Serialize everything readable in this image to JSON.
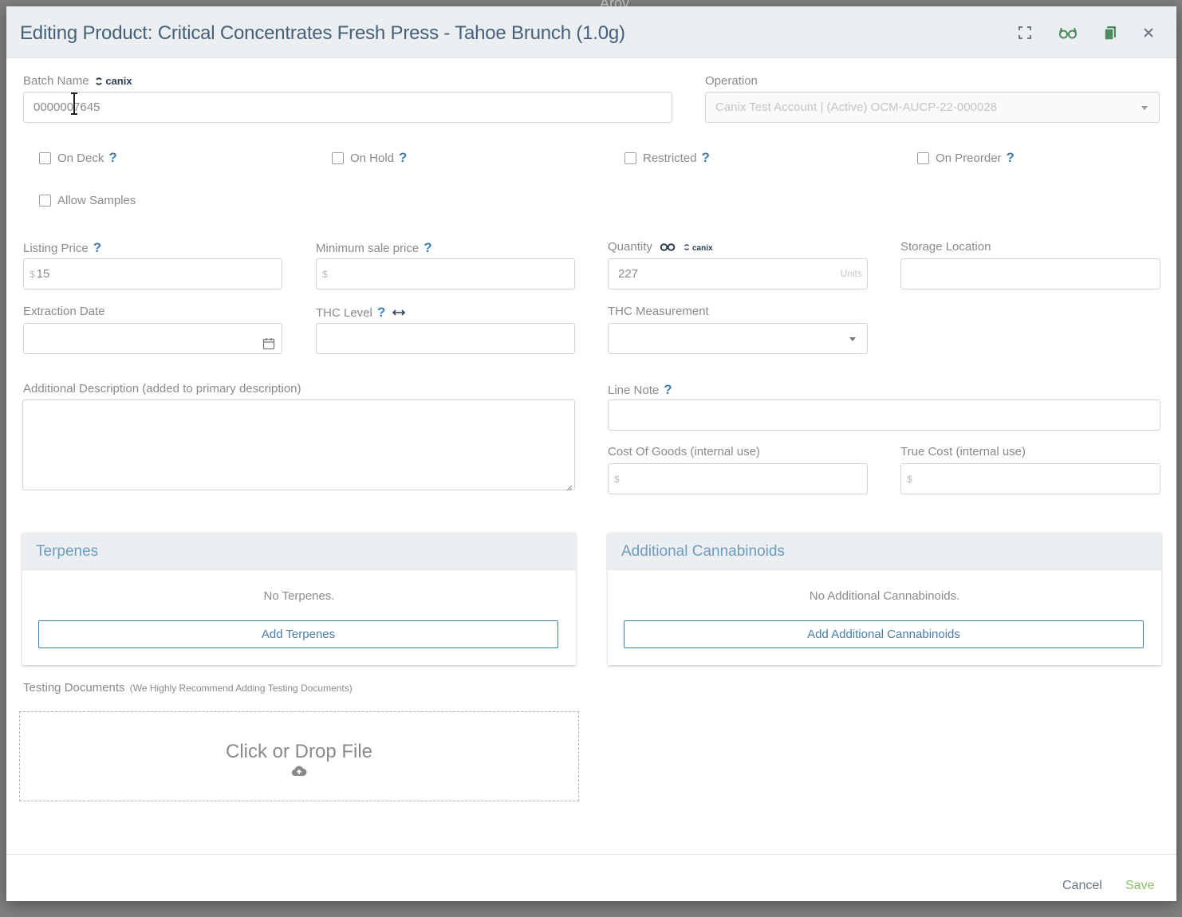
{
  "backdrop": {
    "text": "Arov"
  },
  "header": {
    "title": "Editing Product: Critical Concentrates Fresh Press - Tahoe Brunch (1.0g)",
    "icons": [
      "fullscreen-icon",
      "glasses-icon",
      "copy-icon",
      "close-icon"
    ]
  },
  "batch": {
    "label": "Batch Name",
    "brand": "canix",
    "value": "0000007645"
  },
  "operation": {
    "label": "Operation",
    "value": "Canix Test Account | (Active) OCM-AUCP-22-000028"
  },
  "checkboxes": {
    "on_deck": "On Deck",
    "on_hold": "On Hold",
    "restricted": "Restricted",
    "on_preorder": "On Preorder",
    "allow_samples": "Allow Samples"
  },
  "listing_price": {
    "label": "Listing Price",
    "prefix": "$",
    "value": "15"
  },
  "min_sale_price": {
    "label": "Minimum sale price",
    "prefix": "$"
  },
  "quantity": {
    "label": "Quantity",
    "brand": "canix",
    "value": "227",
    "unit": "Units"
  },
  "storage_location": {
    "label": "Storage Location"
  },
  "extraction_date": {
    "label": "Extraction Date"
  },
  "thc_level": {
    "label": "THC Level"
  },
  "thc_measurement": {
    "label": "THC Measurement"
  },
  "additional_description": {
    "label": "Additional Description (added to primary description)"
  },
  "line_note": {
    "label": "Line Note"
  },
  "cost_of_goods": {
    "label": "Cost Of Goods (internal use)",
    "prefix": "$"
  },
  "true_cost": {
    "label": "True Cost (internal use)",
    "prefix": "$"
  },
  "terpenes": {
    "title": "Terpenes",
    "empty": "No Terpenes.",
    "button": "Add Terpenes"
  },
  "cannabinoids": {
    "title": "Additional Cannabinoids",
    "empty": "No Additional Cannabinoids.",
    "button": "Add Additional Cannabinoids"
  },
  "testing_docs": {
    "label": "Testing Documents",
    "note": "(We Highly Recommend Adding Testing Documents)",
    "dropzone": "Click or Drop File"
  },
  "footer": {
    "cancel": "Cancel",
    "save": "Save"
  },
  "colors": {
    "accent": "#3f7fb3",
    "save": "#8bbf6a",
    "title": "#45607a"
  }
}
